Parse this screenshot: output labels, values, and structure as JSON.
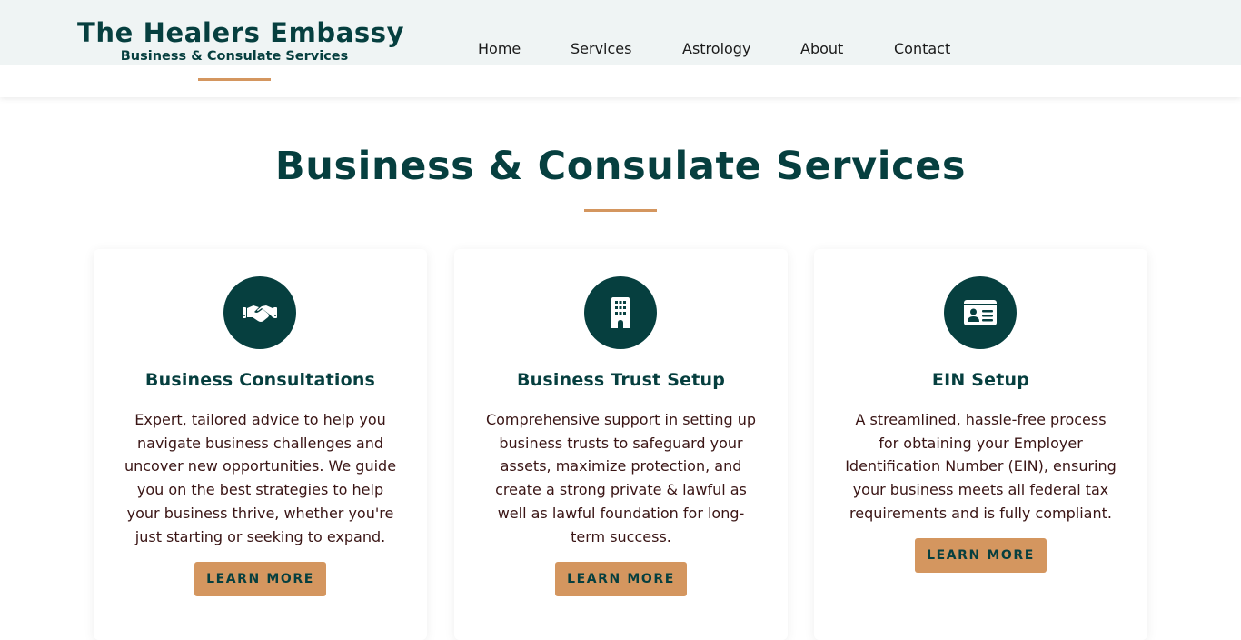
{
  "brand": {
    "title": "The Healers Embassy",
    "subtitle": "Business & Consulate Services"
  },
  "nav": {
    "items": [
      {
        "label": "Home"
      },
      {
        "label": "Services"
      },
      {
        "label": "Astrology"
      },
      {
        "label": "About"
      },
      {
        "label": "Contact"
      }
    ]
  },
  "page": {
    "title": "Business & Consulate Services"
  },
  "cards": [
    {
      "icon": "handshake-icon",
      "title": "Business Consultations",
      "description": "Expert, tailored advice to help you navigate business challenges and uncover new opportunities. We guide you on the best strategies to help your business thrive, whether you're just starting or seeking to expand.",
      "button": "LEARN MORE"
    },
    {
      "icon": "building-icon",
      "title": "Business Trust Setup",
      "description": "Comprehensive support in setting up business trusts to safeguard your assets, maximize protection, and create a strong private & lawful as well as lawful foundation for long-term success.",
      "button": "LEARN MORE"
    },
    {
      "icon": "id-card-icon",
      "title": "EIN Setup",
      "description": "A streamlined, hassle-free process for obtaining your Employer Identification Number (EIN), ensuring your business meets all federal tax requirements and is fully compliant.",
      "button": "LEARN MORE"
    }
  ],
  "colors": {
    "primary": "#063f3f",
    "accent": "#d4965f",
    "header_band": "#eff4f4",
    "body_text": "#3a1515"
  }
}
